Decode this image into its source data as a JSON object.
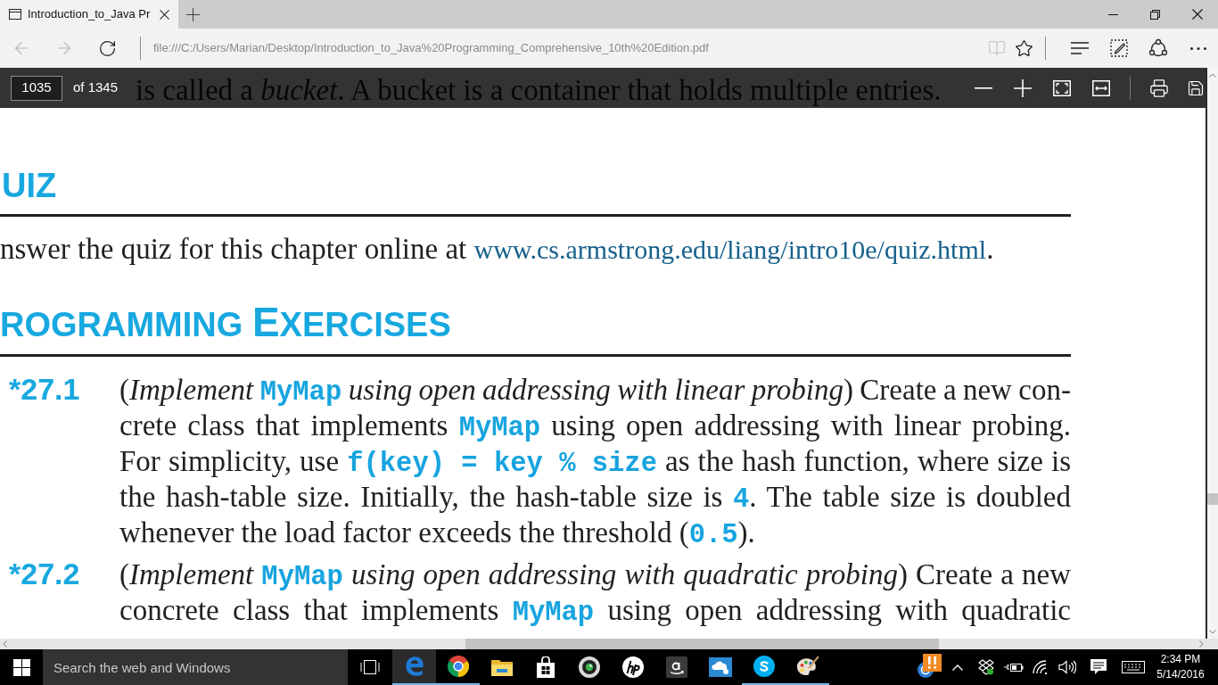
{
  "browser": {
    "tabs": [
      {
        "title": "Introduction_to_Java Pr",
        "selected": true
      }
    ],
    "nav_buttons": [
      {
        "kind": "back",
        "disabled": true
      },
      {
        "kind": "forward",
        "disabled": true
      },
      {
        "kind": "refresh",
        "disabled": false
      }
    ],
    "address": {
      "url": "file:///C:/Users/Marian/Desktop/Introduction_to_Java%20Programming_Comprehensive_10th%20Edition.pdf"
    },
    "page_buttons": [
      {
        "kind": "reading_view",
        "disabled": true
      },
      {
        "kind": "favorite",
        "disabled": false
      }
    ]
  },
  "pdf_toolbar": {
    "page": "1035",
    "page_count": "of 1345"
  },
  "document": {
    "overlaid_line": "is called a *bucket*. A bucket is a container that holds multiple entries.",
    "quiz": {
      "heading": [
        {
          "text": "UIZ",
          "kind": "small_caps"
        }
      ],
      "paragraph": [
        {
          "text": "nswer the quiz for this chapter online at ",
          "kind": "plain"
        },
        {
          "text": "www.cs.armstrong.edu/liang/intro10e/quiz.html",
          "kind": "link"
        },
        {
          "text": ".",
          "kind": "plain"
        }
      ]
    },
    "programming_exercises": {
      "heading": [
        {
          "text": "ROGRAMMING ",
          "kind": "small_caps"
        },
        {
          "text": "E",
          "kind": "capital"
        },
        {
          "text": "XERCISES",
          "kind": "small_caps"
        }
      ],
      "exercises": [
        {
          "number": "*27.1",
          "continues_below": false,
          "lines": [
            [
              {
                "text": "(",
                "kind": "plain"
              },
              {
                "text": "Implement ",
                "kind": "italic"
              },
              {
                "text": "MyMap",
                "kind": "code"
              },
              {
                "text": " using open addressing with linear probing",
                "kind": "italic"
              },
              {
                "text": ") Create a new con-",
                "kind": "plain"
              }
            ],
            [
              {
                "text": "crete class that implements ",
                "kind": "plain"
              },
              {
                "text": "MyMap",
                "kind": "code"
              },
              {
                "text": " using open addressing with linear probing.",
                "kind": "plain"
              }
            ],
            [
              {
                "text": "For simplicity, use ",
                "kind": "plain"
              },
              {
                "text": "f(key) = key % size",
                "kind": "code"
              },
              {
                "text": " as the hash function, where size is",
                "kind": "plain"
              }
            ],
            [
              {
                "text": "the hash-table size. Initially, the hash-table size is ",
                "kind": "plain"
              },
              {
                "text": "4",
                "kind": "code"
              },
              {
                "text": ". The table size is doubled",
                "kind": "plain"
              }
            ],
            [
              {
                "text": "whenever the load factor exceeds the threshold (",
                "kind": "plain"
              },
              {
                "text": "0.5",
                "kind": "code"
              },
              {
                "text": ").",
                "kind": "plain"
              }
            ]
          ]
        },
        {
          "number": "*27.2",
          "continues_below": true,
          "lines": [
            [
              {
                "text": "(",
                "kind": "plain"
              },
              {
                "text": "Implement ",
                "kind": "italic"
              },
              {
                "text": "MyMap",
                "kind": "code"
              },
              {
                "text": " using open addressing with quadratic probing",
                "kind": "italic"
              },
              {
                "text": ") Create a new",
                "kind": "plain"
              }
            ],
            [
              {
                "text": "concrete class that implements ",
                "kind": "plain"
              },
              {
                "text": "MyMap",
                "kind": "code"
              },
              {
                "text": " using open addressing with quadratic",
                "kind": "plain"
              }
            ]
          ]
        }
      ]
    }
  },
  "taskbar": {
    "search": {
      "placeholder": "Search the web and Windows"
    },
    "apps": [
      {
        "kind": "e_logo",
        "running": true,
        "selected": true
      },
      {
        "kind": "ring_logo",
        "running": true,
        "selected": false
      },
      {
        "kind": "folder",
        "running": false,
        "selected": false
      },
      {
        "kind": "store_bag",
        "running": false,
        "selected": false
      },
      {
        "kind": "webcam",
        "running": false,
        "selected": false
      },
      {
        "kind": "circle_logo",
        "running": false,
        "selected": false
      },
      {
        "kind": "a_tile",
        "running": false,
        "selected": false
      },
      {
        "kind": "cloud_tile",
        "running": false,
        "selected": false
      },
      {
        "kind": "s_logo",
        "running": true,
        "selected": false
      },
      {
        "kind": "palette",
        "running": true,
        "selected": false
      }
    ],
    "clock": {
      "time": "2:34 PM",
      "date": "5/14/2016"
    }
  }
}
